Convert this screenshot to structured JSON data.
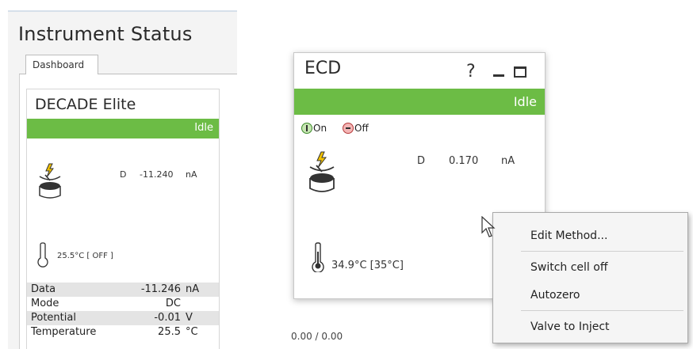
{
  "left_panel": {
    "title": "Instrument Status",
    "tabs": [
      {
        "label": "Dashboard"
      }
    ]
  },
  "decade_card": {
    "title": "DECADE Elite",
    "status": "Idle",
    "channel": "D",
    "reading": "-11.240",
    "unit": "nA",
    "temperature": "25.5°C  [ OFF ]",
    "table": [
      {
        "label": "Data",
        "value": "-11.246",
        "unit": "nA"
      },
      {
        "label": "Mode",
        "value": "DC",
        "unit": ""
      },
      {
        "label": "Potential",
        "value": "-0.01",
        "unit": "V"
      },
      {
        "label": "Temperature",
        "value": "25.5",
        "unit": "°C"
      }
    ]
  },
  "ecd_window": {
    "title": "ECD",
    "help": "?",
    "status": "Idle",
    "on_label": "On",
    "off_label": "Off",
    "channel": "D",
    "reading": "0.170",
    "unit": "nA",
    "temperature": "34.9°C  [35°C]"
  },
  "progress": "0.00 / 0.00",
  "context_menu": {
    "items": [
      "Edit Method...",
      "Switch cell off",
      "Autozero",
      "Valve to Inject"
    ]
  },
  "colors": {
    "status_green": "#6cbc45",
    "on_green": "#c7e6b3",
    "off_red": "#f4b6b6"
  },
  "icons": [
    "cell-lightning-icon",
    "thermometer-icon",
    "power-on-icon",
    "power-off-icon",
    "minimize-icon",
    "maximize-icon",
    "mouse-cursor-icon"
  ]
}
